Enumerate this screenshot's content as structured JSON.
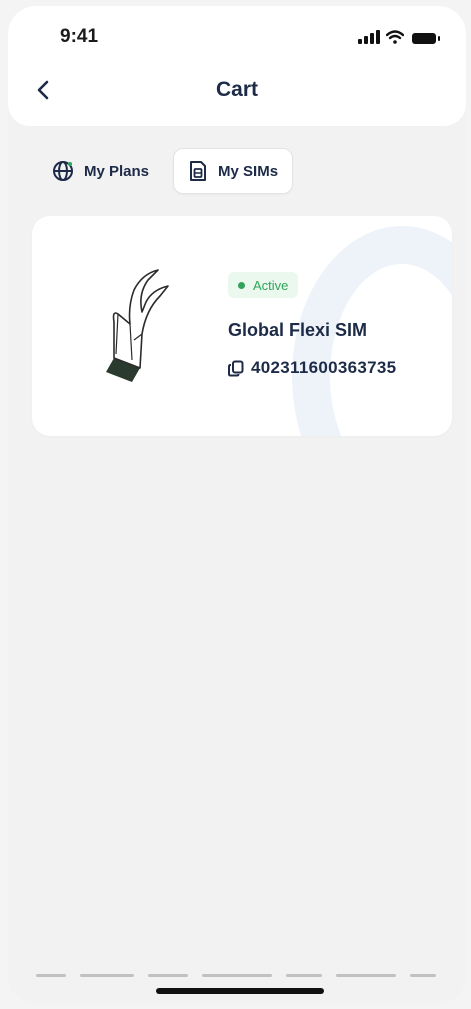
{
  "status_bar": {
    "time": "9:41",
    "icons": [
      "signal-icon",
      "wifi-icon",
      "battery-icon"
    ]
  },
  "header": {
    "title": "Cart",
    "back_icon": "chevron-left-icon"
  },
  "tabs": [
    {
      "label": "My Plans",
      "icon": "globe-icon",
      "active": false
    },
    {
      "label": "My SIMs",
      "icon": "sim-card-icon",
      "active": true
    }
  ],
  "sim_card": {
    "status": "Active",
    "name": "Global Flexi SIM",
    "number": "402311600363735",
    "number_icon": "copy-icon",
    "illustration": "sim-illustration",
    "status_color": "#2fa35a"
  },
  "colors": {
    "primary_text": "#1d2b48",
    "background": "#f2f2f2",
    "card": "#ffffff",
    "active_green": "#2fa35a",
    "active_green_bg": "#eaf8ee"
  }
}
